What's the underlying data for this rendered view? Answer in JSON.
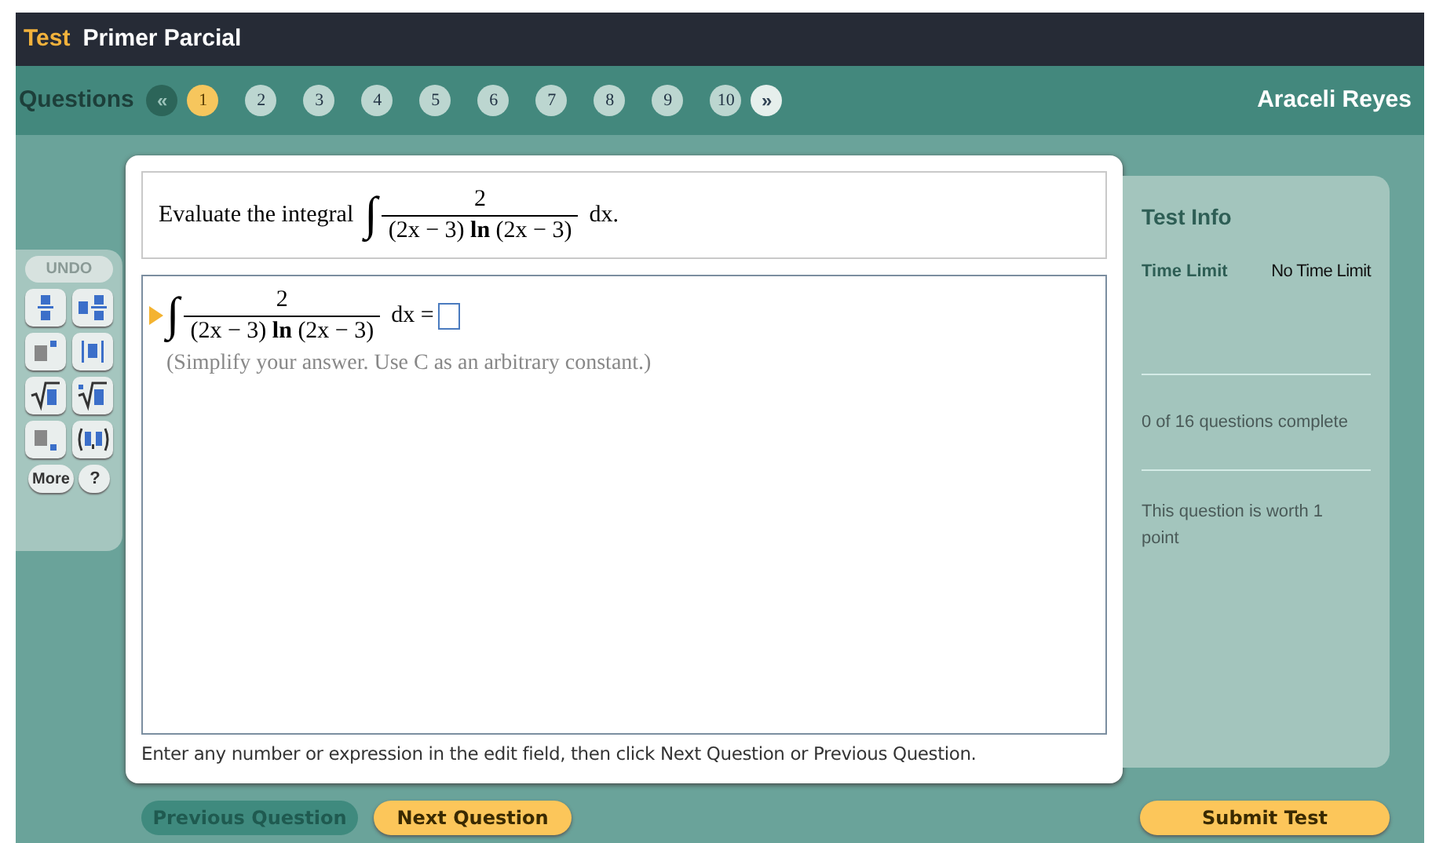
{
  "header": {
    "label": "Test",
    "title": "Primer Parcial"
  },
  "nav": {
    "label": "Questions",
    "prev": {
      "text": "«",
      "disabled": true
    },
    "next": {
      "text": "»",
      "disabled": false
    },
    "questions": [
      {
        "label": "1",
        "selected": true
      },
      {
        "label": "2",
        "selected": false
      },
      {
        "label": "3",
        "selected": false
      },
      {
        "label": "4",
        "selected": false
      },
      {
        "label": "5",
        "selected": false
      },
      {
        "label": "6",
        "selected": false
      },
      {
        "label": "7",
        "selected": false
      },
      {
        "label": "8",
        "selected": false
      },
      {
        "label": "9",
        "selected": false
      },
      {
        "label": "10",
        "selected": false
      }
    ],
    "user": "Araceli Reyes"
  },
  "toolbar": {
    "undo": "UNDO",
    "templates": [
      {
        "kind": "fraction"
      },
      {
        "kind": "mixed"
      },
      {
        "kind": "exponent"
      },
      {
        "kind": "abs"
      },
      {
        "kind": "sqrt"
      },
      {
        "kind": "nthroot"
      },
      {
        "kind": "subscript"
      },
      {
        "kind": "pair"
      }
    ],
    "more": "More",
    "help": "?"
  },
  "question": {
    "prompt": "Evaluate the integral",
    "integral": "∫",
    "numerator": "2",
    "denominator": "(2x − 3) **ln** (2x − 3)",
    "tail": "dx."
  },
  "answer": {
    "integral": "∫",
    "numerator": "2",
    "denominator": "(2x − 3) **ln** (2x − 3)",
    "tail": "dx =",
    "hint": "(Simplify your answer. Use C as an arbitrary constant.)"
  },
  "instructions": "Enter any number or expression in the edit field, then click Next Question or Previous Question.",
  "info": {
    "title": "Test Info",
    "time_label": "Time Limit",
    "time_value": "No Time Limit",
    "progress": "0 of 16 questions complete",
    "worth": "This question is worth 1 point"
  },
  "buttons": {
    "previous": {
      "label": "Previous Question",
      "disabled": true
    },
    "next": {
      "label": "Next Question",
      "disabled": false
    },
    "submit": {
      "label": "Submit Test",
      "disabled": false
    }
  }
}
